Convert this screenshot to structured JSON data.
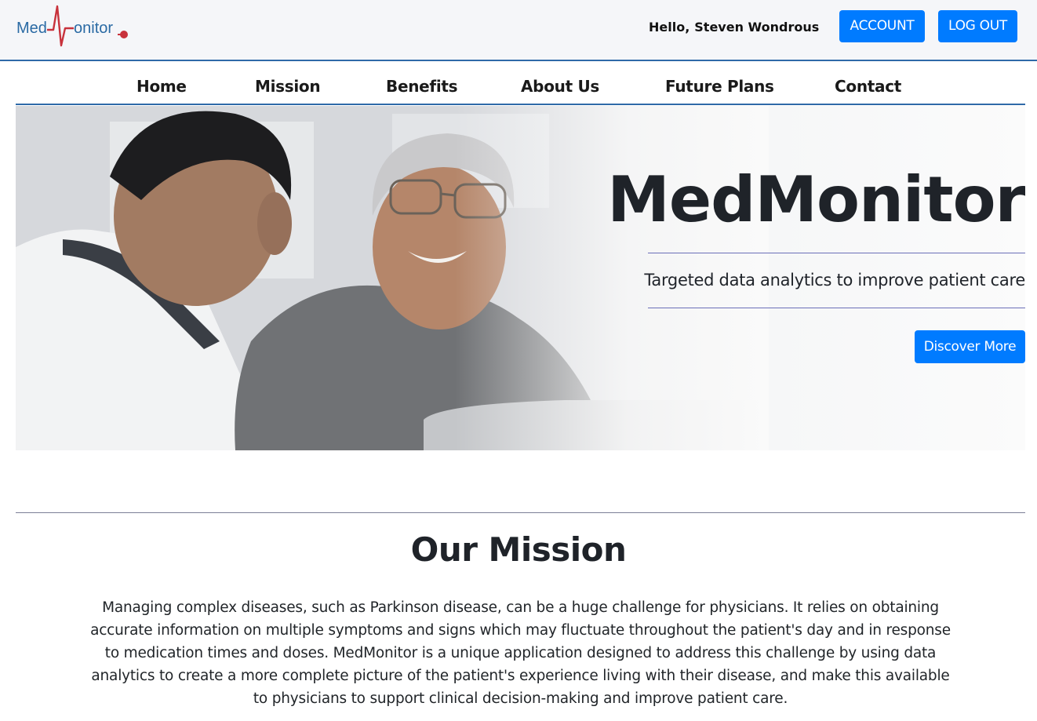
{
  "header": {
    "logo_text_left": "Med",
    "logo_text_right": "onitor",
    "greeting": "Hello,",
    "user_name": "Steven Wondrous",
    "account_label": "ACCOUNT",
    "logout_label": "LOG OUT"
  },
  "nav": {
    "items": [
      {
        "label": "Home"
      },
      {
        "label": "Mission"
      },
      {
        "label": "Benefits"
      },
      {
        "label": "About Us"
      },
      {
        "label": "Future Plans"
      },
      {
        "label": "Contact"
      }
    ]
  },
  "hero": {
    "title": "MedMonitor",
    "tagline": "Targeted data analytics to improve patient care",
    "cta_label": "Discover More"
  },
  "mission": {
    "title": "Our Mission",
    "body": "Managing complex diseases, such as Parkinson disease, can be a huge challenge for physicians. It relies on obtaining accurate information on multiple symptoms and signs which may fluctuate throughout the patient's day and in response to medication times and doses. MedMonitor is a unique application designed to address this challenge by using data analytics to create a more complete picture of the patient's experience living with their disease, and make this available to physicians to support clinical decision-making and improve patient care."
  },
  "colors": {
    "primary": "#007bff",
    "rule_blue": "#2f6aa8",
    "logo_blue": "#2a6aa4",
    "logo_red": "#c8323c"
  }
}
